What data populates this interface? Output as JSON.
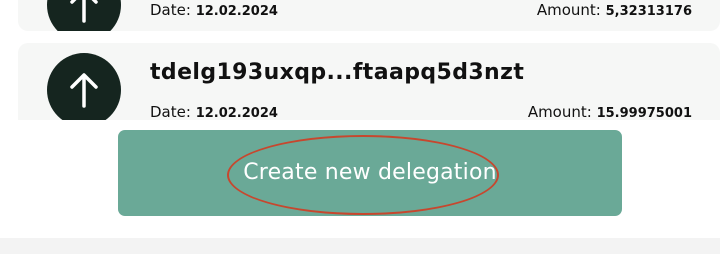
{
  "transactions": [
    {
      "title": "",
      "direction_icon": "arrow-up-icon",
      "date_label": "Date:",
      "date_value": "12.02.2024",
      "amount_label": "Amount:",
      "amount_value": "5,32313176"
    },
    {
      "title": "tdelg193uxqp...ftaapq5d3nzt",
      "direction_icon": "arrow-up-icon",
      "date_label": "Date:",
      "date_value": "12.02.2024",
      "amount_label": "Amount:",
      "amount_value": "15.99975001"
    }
  ],
  "create_button": {
    "label": "Create new delegation"
  },
  "colors": {
    "button": "#6aa997",
    "icon_circle": "#15251f",
    "annotation": "#c7472e"
  }
}
